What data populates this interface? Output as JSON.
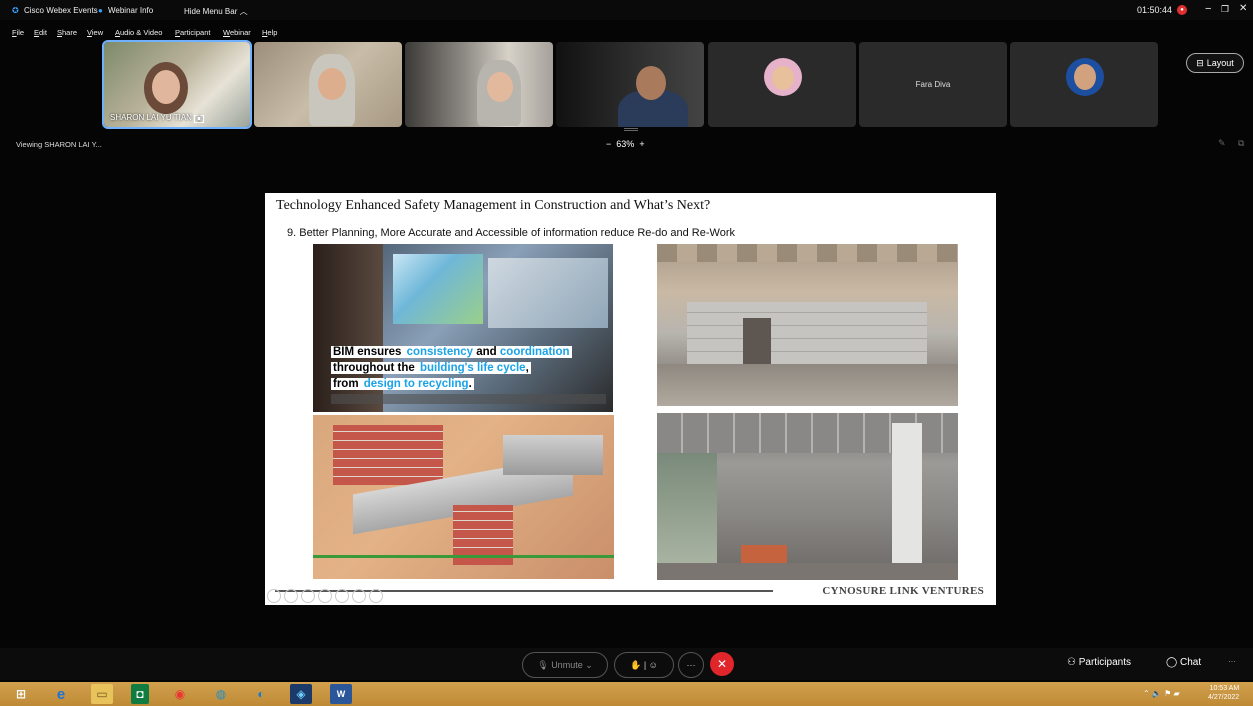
{
  "titlebar": {
    "app": "Cisco Webex Events",
    "info": "Webinar Info",
    "hide": "Hide Menu Bar",
    "timer": "01:50:44"
  },
  "menu": [
    "File",
    "Edit",
    "Share",
    "View",
    "Audio & Video",
    "Participant",
    "Webinar",
    "Help"
  ],
  "thumbnails": {
    "speaker_label": "SHARON LAI YU TIAN",
    "name_only": "Fara Diva"
  },
  "layout_label": "Layout",
  "viewing_text": "Viewing SHARON LAI Y...",
  "zoom": {
    "minus": "−",
    "value": "63%",
    "plus": "+"
  },
  "slide": {
    "title": "Technology Enhanced Safety Management in Construction and What’s Next?",
    "subtitle": "9. Better Planning, More Accurate and Accessible of information reduce Re-do and Re-Work",
    "bim_line1_a": "BIM ensures ",
    "bim_line1_b": "consistency",
    "bim_line1_c": " and ",
    "bim_line1_d": "coordination",
    "bim_line2_a": "throughout the ",
    "bim_line2_b": "building's life cycle",
    "bim_line2_c": ",",
    "bim_line3_a": "from ",
    "bim_line3_b": "design to recycling",
    "bim_line3_c": ".",
    "footer": "CYNOSURE LINK VENTURES"
  },
  "controls": {
    "unmute": "Unmute",
    "participants": "Participants",
    "chat": "Chat",
    "more": "···"
  },
  "taskbar": {
    "time": "10:53 AM",
    "date": "4/27/2022"
  },
  "colors": {
    "accent_blue": "#1aa3e8",
    "end_red": "#e0262a",
    "rec_red": "#e03030",
    "taskbar": "#c9963f"
  }
}
